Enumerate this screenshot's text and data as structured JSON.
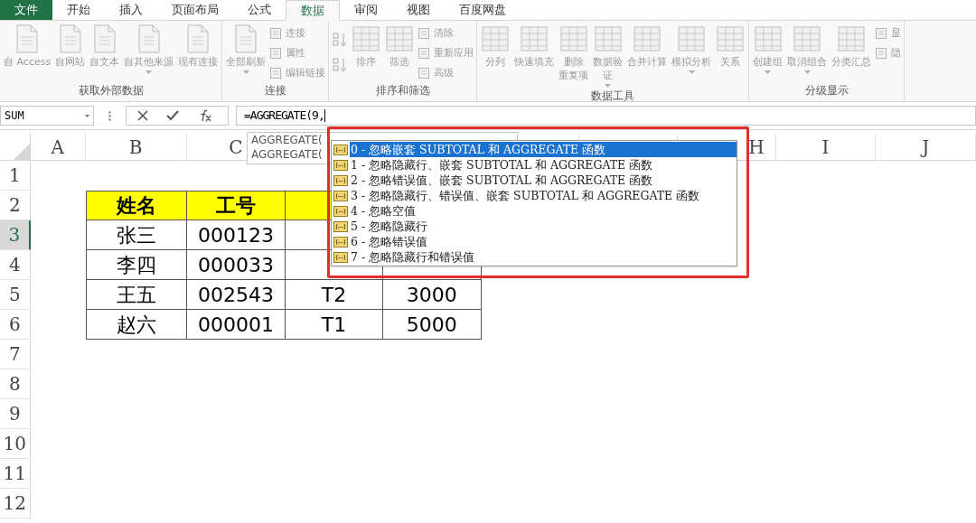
{
  "tabs": [
    {
      "label": "文件",
      "kind": "file",
      "selected": false
    },
    {
      "label": "开始",
      "kind": "tab",
      "selected": false
    },
    {
      "label": "插入",
      "kind": "tab",
      "selected": false
    },
    {
      "label": "页面布局",
      "kind": "tab",
      "selected": false
    },
    {
      "label": "公式",
      "kind": "tab",
      "selected": false
    },
    {
      "label": "数据",
      "kind": "tab",
      "selected": true
    },
    {
      "label": "审阅",
      "kind": "tab",
      "selected": false
    },
    {
      "label": "视图",
      "kind": "tab",
      "selected": false
    },
    {
      "label": "百度网盘",
      "kind": "tab",
      "selected": false
    }
  ],
  "ribbon_groups": [
    {
      "label": "获取外部数据",
      "buttons": [
        {
          "kind": "large",
          "lines": [
            "自 Access"
          ],
          "dropdown": false
        },
        {
          "kind": "large",
          "lines": [
            "自网站"
          ],
          "dropdown": false
        },
        {
          "kind": "large",
          "lines": [
            "自文本"
          ],
          "dropdown": false
        },
        {
          "kind": "large",
          "lines": [
            "自其他来源"
          ],
          "dropdown": true
        },
        {
          "kind": "large",
          "lines": [
            "现有连接"
          ],
          "dropdown": false
        }
      ]
    },
    {
      "label": "连接",
      "buttons": [
        {
          "kind": "large",
          "lines": [
            "全部刷新"
          ],
          "dropdown": true
        },
        {
          "kind": "small",
          "lines": [
            "连接",
            "属性",
            "编辑链接"
          ]
        }
      ]
    },
    {
      "label": "排序和筛选",
      "buttons": [
        {
          "kind": "sort"
        },
        {
          "kind": "large",
          "lines": [
            "排序"
          ],
          "dropdown": false
        },
        {
          "kind": "large",
          "lines": [
            "筛选"
          ],
          "dropdown": false
        },
        {
          "kind": "small",
          "lines": [
            "清除",
            "重新应用",
            "高级"
          ]
        }
      ]
    },
    {
      "label": "数据工具",
      "buttons": [
        {
          "kind": "large",
          "lines": [
            "分列"
          ],
          "dropdown": false
        },
        {
          "kind": "large",
          "lines": [
            "快速填充"
          ],
          "dropdown": false
        },
        {
          "kind": "large",
          "lines": [
            "删除",
            "重复项"
          ],
          "dropdown": false
        },
        {
          "kind": "large",
          "lines": [
            "数据验",
            "证"
          ],
          "dropdown": true
        },
        {
          "kind": "large",
          "lines": [
            "合并计算"
          ],
          "dropdown": false
        },
        {
          "kind": "large",
          "lines": [
            "模拟分析"
          ],
          "dropdown": true
        },
        {
          "kind": "large",
          "lines": [
            "关系"
          ],
          "dropdown": false
        }
      ]
    },
    {
      "label": "分级显示",
      "buttons": [
        {
          "kind": "large",
          "lines": [
            "创建组"
          ],
          "dropdown": true
        },
        {
          "kind": "large",
          "lines": [
            "取消组合"
          ],
          "dropdown": true
        },
        {
          "kind": "large",
          "lines": [
            "分类汇总"
          ],
          "dropdown": false
        },
        {
          "kind": "small",
          "lines": [
            "显",
            "隐"
          ]
        }
      ]
    }
  ],
  "name_box": "SUM",
  "formula": "=AGGREGATE(9,",
  "columns": [
    "A",
    "B",
    "C",
    "H",
    "I",
    "J"
  ],
  "rows": [
    {
      "label": "1",
      "selected": false
    },
    {
      "label": "2",
      "selected": false
    },
    {
      "label": "3",
      "selected": true
    },
    {
      "label": "4",
      "selected": false
    },
    {
      "label": "5",
      "selected": false
    },
    {
      "label": "6",
      "selected": false
    },
    {
      "label": "7",
      "selected": false
    },
    {
      "label": "8",
      "selected": false
    },
    {
      "label": "9",
      "selected": false
    },
    {
      "label": "10",
      "selected": false
    },
    {
      "label": "11",
      "selected": false
    },
    {
      "label": "12",
      "selected": false
    }
  ],
  "table": {
    "header": [
      "姓名",
      "工号"
    ],
    "rows": [
      [
        "张三",
        "000123"
      ],
      [
        "李四",
        "000033"
      ],
      [
        "王五",
        "002543",
        "T2",
        "3000"
      ],
      [
        "赵六",
        "000001",
        "T1",
        "5000"
      ]
    ]
  },
  "tooltip": [
    "AGGREGATE(",
    "AGGREGATE("
  ],
  "autocomplete": [
    {
      "label": "0 - 忽略嵌套 SUBTOTAL 和 AGGREGATE 函数",
      "selected": true
    },
    {
      "label": "1 - 忽略隐藏行、嵌套 SUBTOTAL 和 AGGREGATE 函数",
      "selected": false
    },
    {
      "label": "2 - 忽略错误值、嵌套 SUBTOTAL 和 AGGREGATE 函数",
      "selected": false
    },
    {
      "label": "3 - 忽略隐藏行、错误值、嵌套 SUBTOTAL 和 AGGREGATE 函数",
      "selected": false
    },
    {
      "label": "4 - 忽略空值",
      "selected": false
    },
    {
      "label": "5 - 忽略隐藏行",
      "selected": false
    },
    {
      "label": "6 - 忽略错误值",
      "selected": false
    },
    {
      "label": "7 - 忽略隐藏行和错误值",
      "selected": false
    }
  ]
}
